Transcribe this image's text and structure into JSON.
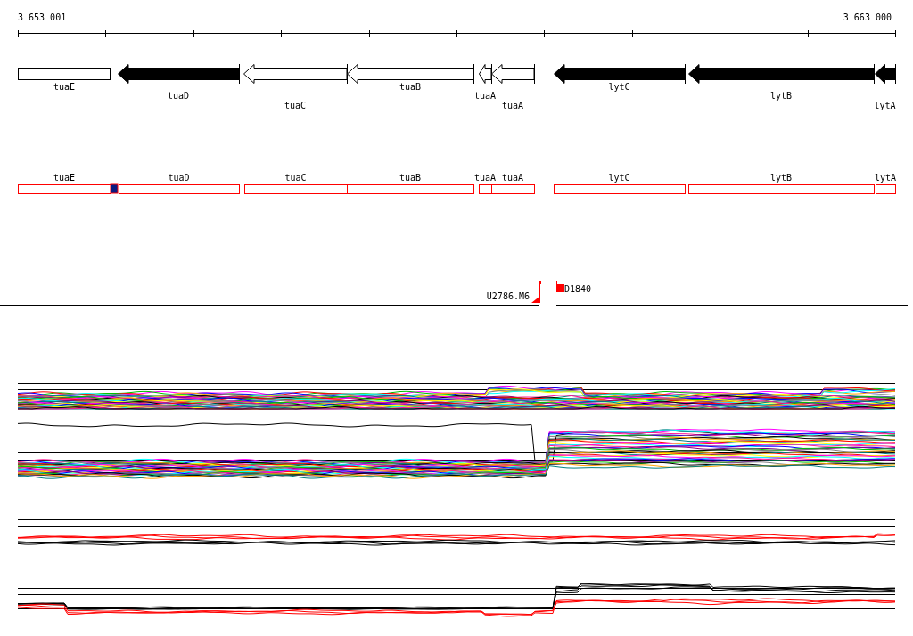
{
  "ruler": {
    "start_label": "3 653 001",
    "end_label": "3 663 000"
  },
  "genes": [
    {
      "label": "tuaE",
      "kind": "box"
    },
    {
      "label": "tuaD",
      "kind": "filled"
    },
    {
      "label": "tuaC",
      "kind": "outline"
    },
    {
      "label": "tuaB",
      "kind": "outline"
    },
    {
      "label": "tuaA",
      "kind": "outline"
    },
    {
      "label": "tuaA",
      "kind": "outline"
    },
    {
      "label": "lytC",
      "kind": "filled"
    },
    {
      "label": "lytB",
      "kind": "filled"
    },
    {
      "label": "lytA",
      "kind": "filled"
    }
  ],
  "regions": [
    {
      "label": "tuaE"
    },
    {
      "label": "tuaD"
    },
    {
      "label": "tuaC"
    },
    {
      "label": "tuaB"
    },
    {
      "label": "tuaA"
    },
    {
      "label": "tuaA"
    },
    {
      "label": "lytC"
    },
    {
      "label": "lytB"
    },
    {
      "label": "lytA"
    }
  ],
  "markers": [
    {
      "label": "U2786.M6",
      "kind": "triangle"
    },
    {
      "label": "D1840",
      "kind": "square"
    }
  ]
}
